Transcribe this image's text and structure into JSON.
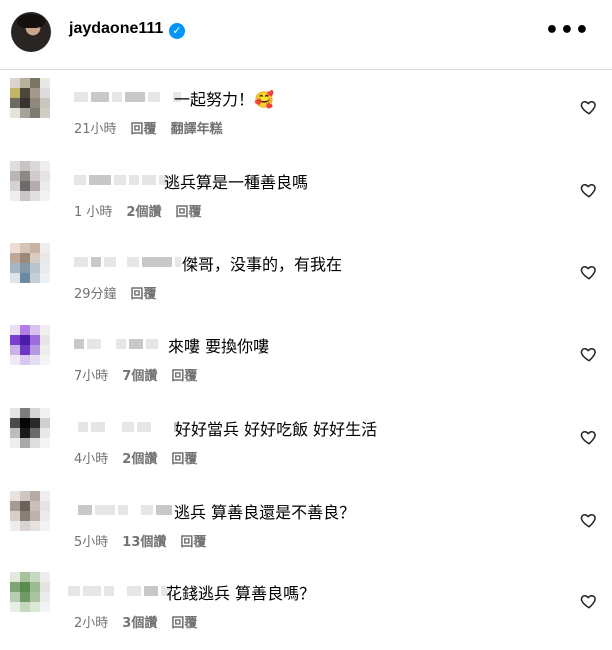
{
  "header": {
    "username": "jaydaone111",
    "more_label": "•••"
  },
  "comments": [
    {
      "text": "一起努力！🥰",
      "time": "21小時",
      "likes": "",
      "reply": "回覆",
      "translate": "翻譯年糕",
      "avatar_colors": [
        "#d9d4cc",
        "#b7b09c",
        "#7c7563",
        "#e8e8e4",
        "#c2b56a",
        "#4d463a",
        "#a39a8b",
        "#dcdcdc",
        "#6f6a60",
        "#383330",
        "#8f887b",
        "#c9c5bf",
        "#e6e2dc",
        "#a8a39a",
        "#7e7a74",
        "#d0ccc6"
      ]
    },
    {
      "text": "逃兵算是一種善良嗎",
      "time": "1 小時",
      "likes": "2個讚",
      "reply": "回覆",
      "translate": "",
      "avatar_colors": [
        "#e0dddd",
        "#c9c4c3",
        "#dcd8d8",
        "#eeeeee",
        "#bbb6b5",
        "#8e8988",
        "#cfcccb",
        "#e4e4e4",
        "#d6d2d1",
        "#6f6a69",
        "#b2adac",
        "#ebebeb",
        "#eeeeee",
        "#cac6c5",
        "#e2dfdf",
        "#f2f2f2"
      ]
    },
    {
      "text": "傑哥，没事的，有我在",
      "time": "29分鐘",
      "likes": "",
      "reply": "回覆",
      "translate": "",
      "avatar_colors": [
        "#e9ddd6",
        "#d7c3b6",
        "#c8b2a2",
        "#eeeeee",
        "#bfa89a",
        "#9c8878",
        "#d9ccc2",
        "#e8e8e8",
        "#a7b6c2",
        "#8698a8",
        "#b8c4cd",
        "#eaeaea",
        "#dfe4e8",
        "#6d8aa0",
        "#c4ced6",
        "#f0f0f0"
      ]
    },
    {
      "text": "來嘍 要換你嘍",
      "time": "7小時",
      "likes": "7個讚",
      "reply": "回覆",
      "translate": "",
      "avatar_colors": [
        "#e9e0f3",
        "#b27ee6",
        "#d7c4ef",
        "#efefef",
        "#7a3fd0",
        "#4a1ea8",
        "#9d6de0",
        "#e6e6e6",
        "#c9b2ea",
        "#6c36c3",
        "#b59ae0",
        "#ededed",
        "#efe9f6",
        "#d8c8ef",
        "#e6dcf3",
        "#f4f4f4"
      ]
    },
    {
      "text": "好好當兵 好好吃飯 好好生活",
      "time": "4小時",
      "likes": "2個讚",
      "reply": "回覆",
      "translate": "",
      "avatar_colors": [
        "#e4e4e4",
        "#7d7d7d",
        "#d6d6d6",
        "#f0f0f0",
        "#4a4a4a",
        "#050505",
        "#2a2a2a",
        "#cfcfcf",
        "#bdbdbd",
        "#1a1a1a",
        "#6a6a6a",
        "#e8e8e8",
        "#eeeeee",
        "#a9a9a9",
        "#dddddd",
        "#f4f4f4"
      ]
    },
    {
      "text": "逃兵 算善良還是不善良？",
      "time": "5小時",
      "likes": "13個讚",
      "reply": "回覆",
      "translate": "",
      "avatar_colors": [
        "#e8e3e0",
        "#cfc6c0",
        "#b7aca5",
        "#eeeeee",
        "#a69a91",
        "#6d625b",
        "#c9bfb8",
        "#e4e4e4",
        "#d7cfc9",
        "#8a7f77",
        "#bdb3ac",
        "#ebebeb",
        "#efeceb",
        "#dad4d0",
        "#e6e2df",
        "#f3f3f3"
      ]
    },
    {
      "text": "花錢逃兵 算善良嗎？",
      "time": "2小時",
      "likes": "3個讚",
      "reply": "回覆",
      "translate": "",
      "avatar_colors": [
        "#dfe9dc",
        "#a6c39e",
        "#c8d9c2",
        "#eeeeee",
        "#7fa574",
        "#5b8a4f",
        "#9bbb91",
        "#e4e4e4",
        "#b7cfb0",
        "#6f9a63",
        "#a9c5a1",
        "#ebebeb",
        "#e6efe3",
        "#c5d8bf",
        "#dbe7d7",
        "#f3f3f3"
      ]
    }
  ]
}
